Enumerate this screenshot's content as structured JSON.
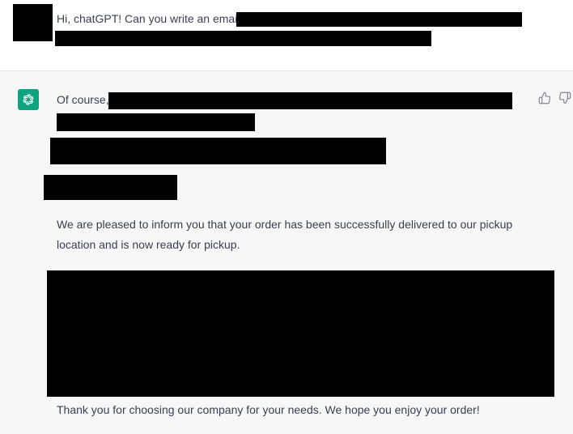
{
  "conversation": {
    "user_message": {
      "text_visible": "Hi, chatGPT! Can you write an email"
    },
    "assistant_message": {
      "opening": "Of course,",
      "paragraph_1_line_1": "We are pleased to inform you that your order has been successfully delivered to our pickup",
      "paragraph_1_line_2": "location and is now ready for pickup.",
      "closing_line": "Thank you for choosing our company for your needs. We hope you enjoy your order!"
    }
  },
  "icons": {
    "assistant_avatar": "openai-logo-icon",
    "feedback_up": "thumbs-up-icon",
    "feedback_down": "thumbs-down-icon"
  },
  "colors": {
    "assistant_avatar_bg": "#10a37f",
    "assistant_row_bg": "#f7f7f8",
    "text": "#374151",
    "redaction": "#000000"
  }
}
